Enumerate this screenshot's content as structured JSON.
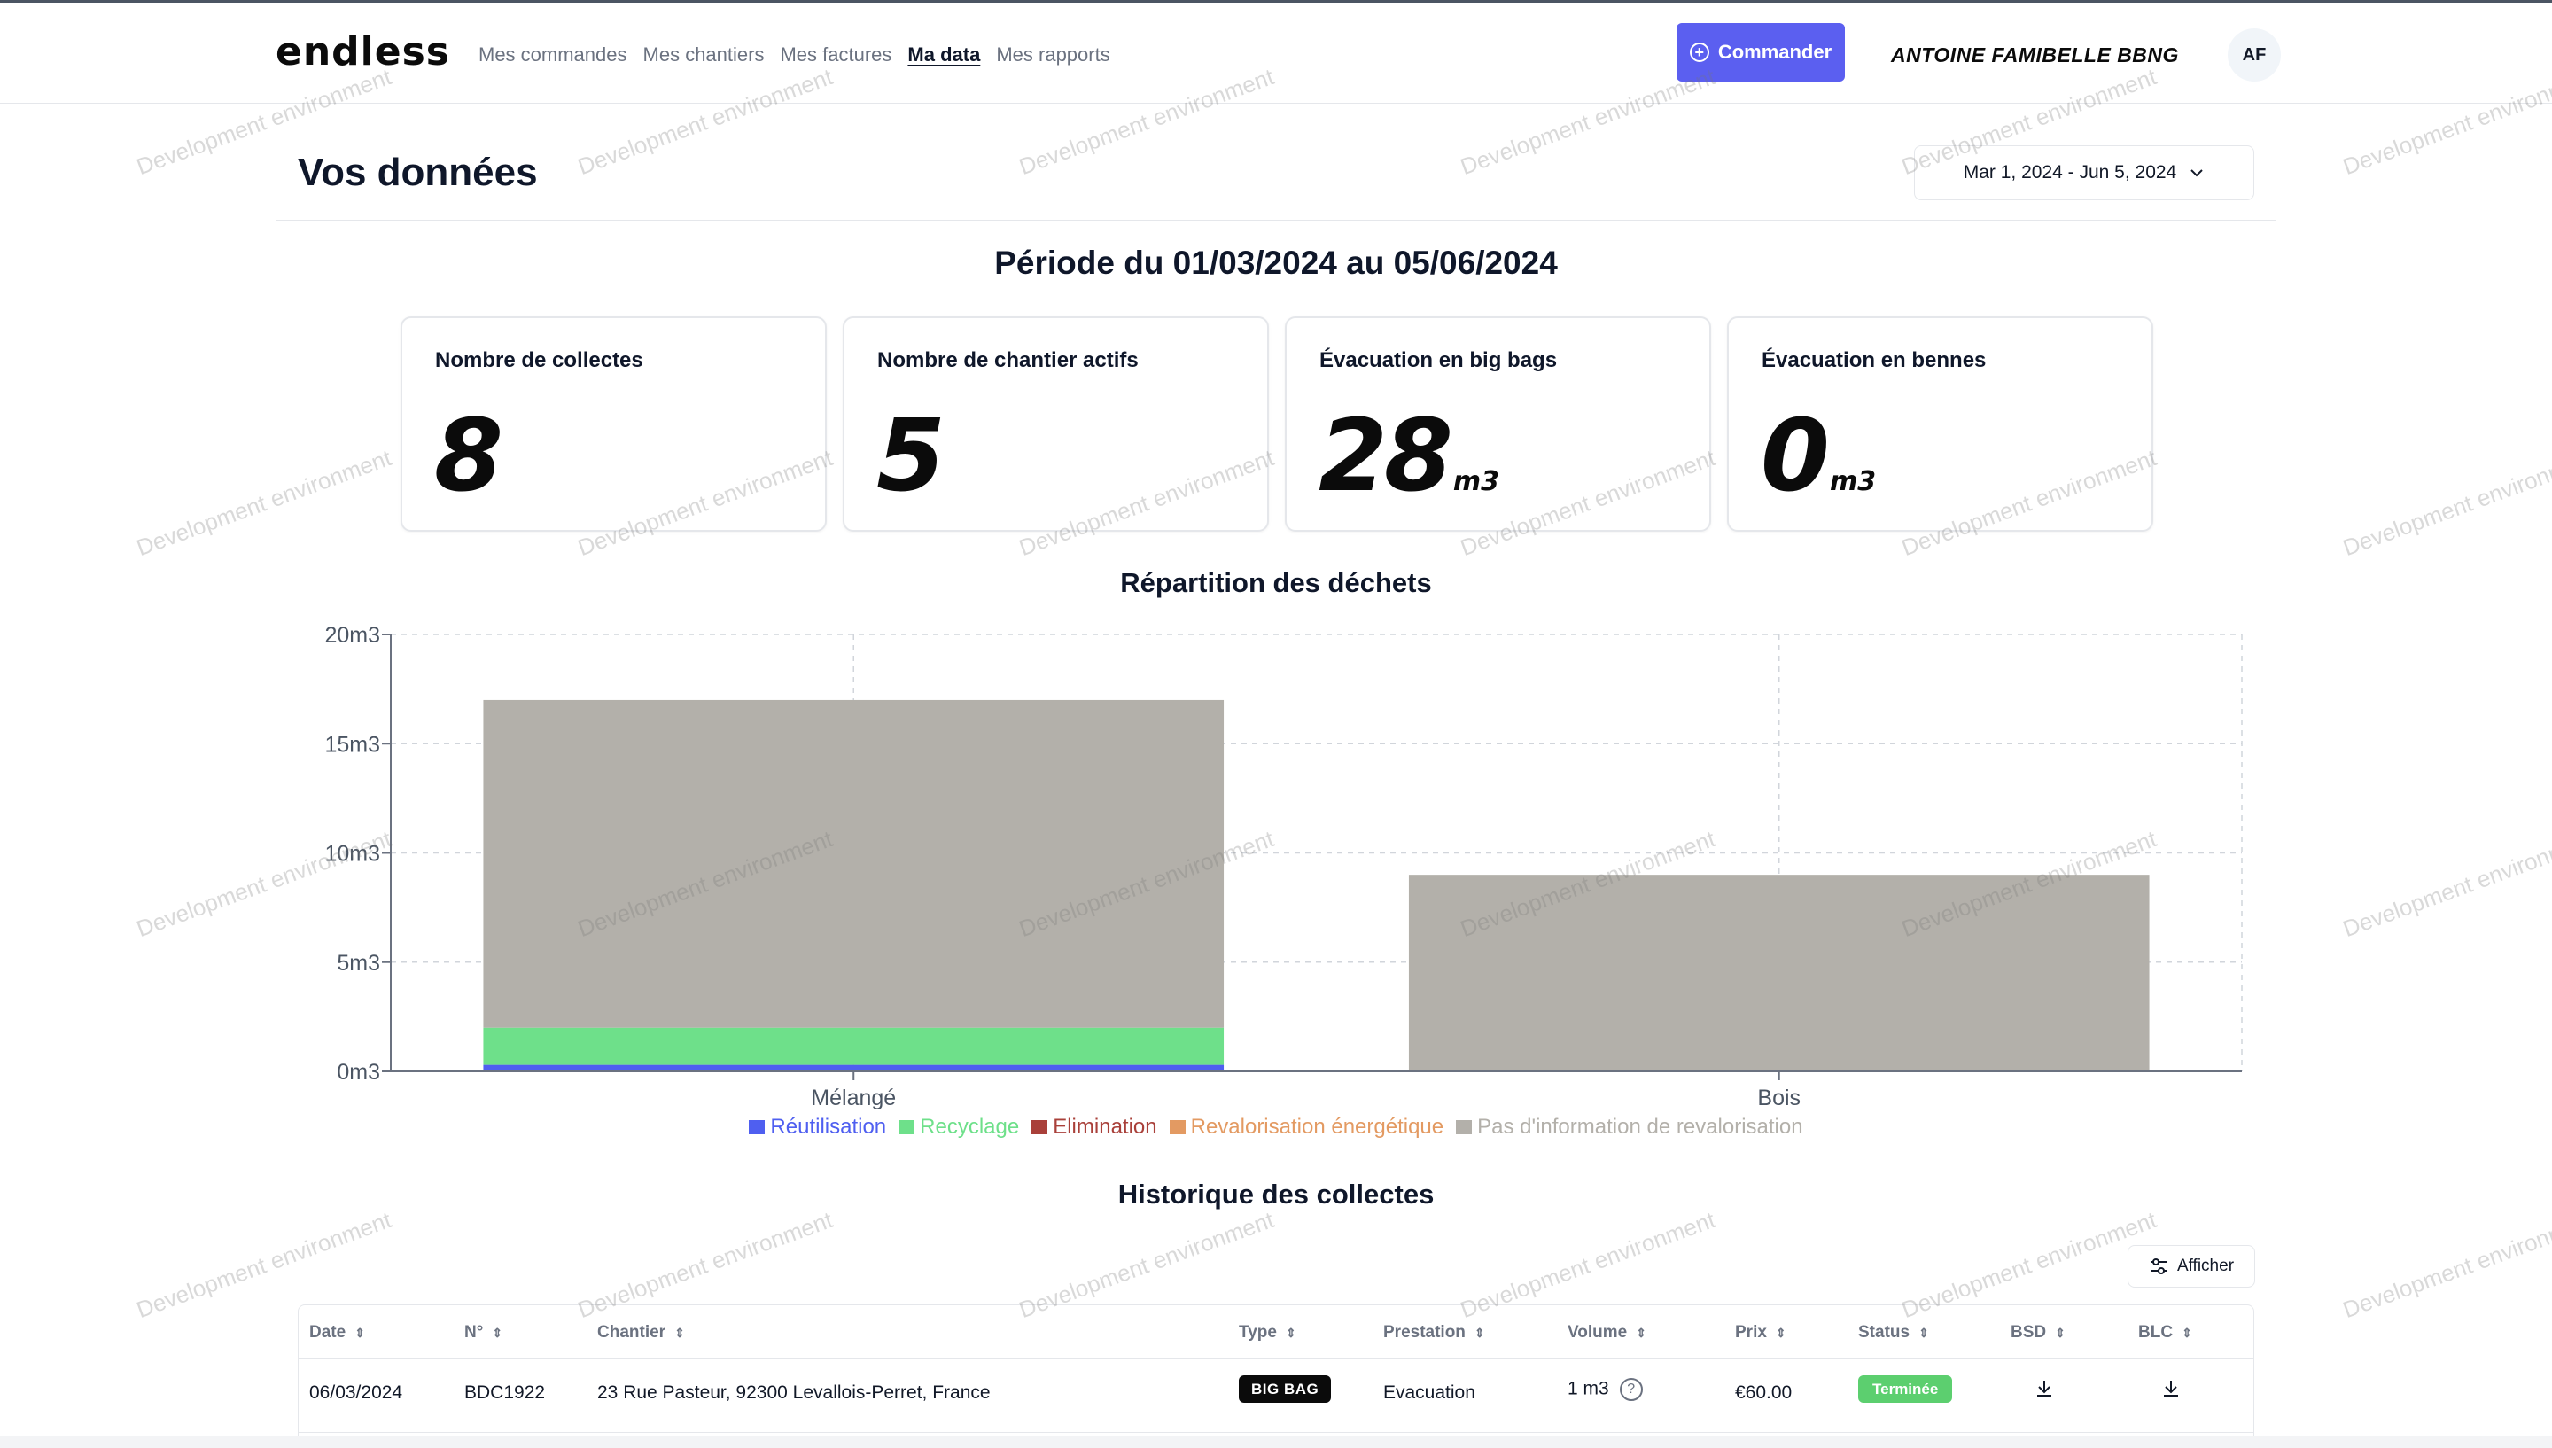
{
  "nav": {
    "logo": "endless",
    "links": [
      "Mes commandes",
      "Mes chantiers",
      "Mes factures",
      "Ma data",
      "Mes rapports"
    ],
    "active_index": 3,
    "commander_label": "Commander",
    "user_name": "ANTOINE FAMIBELLE BBNG",
    "avatar_initials": "AF"
  },
  "header": {
    "title": "Vos données",
    "date_range": "Mar 1, 2024 - Jun 5, 2024",
    "period": "Période du 01/03/2024 au 05/06/2024"
  },
  "stats": [
    {
      "label": "Nombre de collectes",
      "value": "8",
      "unit": ""
    },
    {
      "label": "Nombre de chantier actifs",
      "value": "5",
      "unit": ""
    },
    {
      "label": "Évacuation en big bags",
      "value": "28",
      "unit": "m3"
    },
    {
      "label": "Évacuation en bennes",
      "value": "0",
      "unit": "m3"
    }
  ],
  "watermark": "Development environment",
  "chart_data": {
    "type": "bar",
    "stacked": true,
    "title": "Répartition des déchets",
    "categories": [
      "Mélangé",
      "Bois"
    ],
    "series": [
      {
        "name": "Réutilisation",
        "color": "#4f5ff0",
        "values": [
          0.3,
          0
        ]
      },
      {
        "name": "Recyclage",
        "color": "#6ee08a",
        "values": [
          1.7,
          0
        ]
      },
      {
        "name": "Elimination",
        "color": "#a9403a",
        "values": [
          0,
          0
        ]
      },
      {
        "name": "Revalorisation énergétique",
        "color": "#e39a62",
        "values": [
          0,
          0
        ]
      },
      {
        "name": "Pas d'information de revalorisation",
        "color": "#b3b0aa",
        "values": [
          15.0,
          9.0
        ]
      }
    ],
    "ylim": [
      0,
      20
    ],
    "yticks": [
      0,
      5,
      10,
      15,
      20
    ],
    "ytick_labels": [
      "0m3",
      "5m3",
      "10m3",
      "15m3",
      "20m3"
    ],
    "grid": true,
    "legend_position": "bottom"
  },
  "history": {
    "title": "Historique des collectes",
    "afficher_label": "Afficher",
    "columns": [
      "Date",
      "N°",
      "Chantier",
      "Type",
      "Prestation",
      "Volume",
      "Prix",
      "Status",
      "BSD",
      "BLC"
    ],
    "rows": [
      {
        "date": "06/03/2024",
        "numero": "BDC1922",
        "chantier": "23 Rue Pasteur, 92300 Levallois-Perret, France",
        "type": "BIG BAG",
        "prestation": "Evacuation",
        "volume": "1 m3",
        "prix": "€60.00",
        "status": "Terminée"
      }
    ]
  }
}
